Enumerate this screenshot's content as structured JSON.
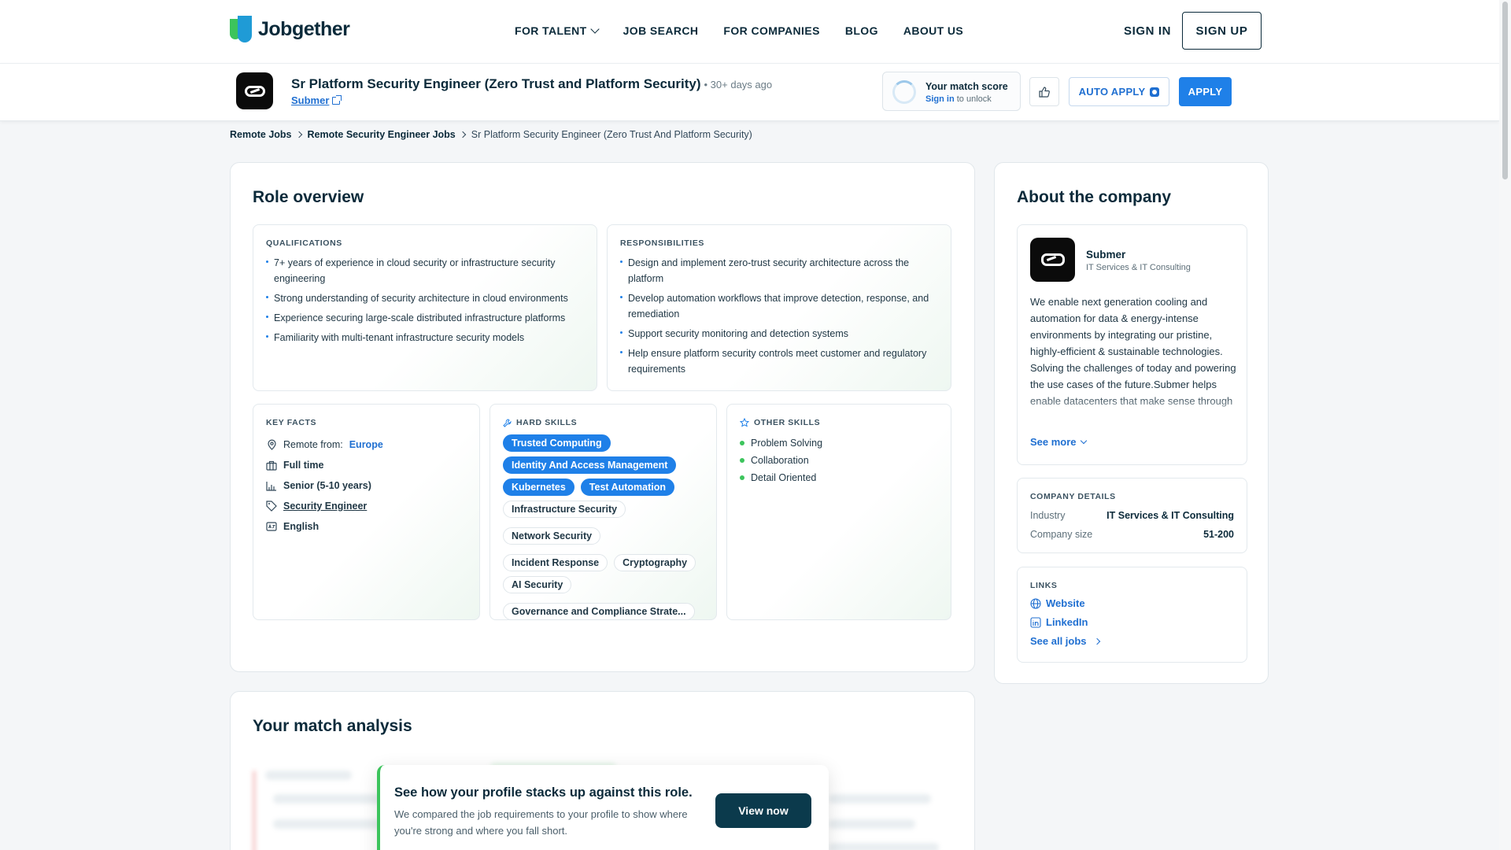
{
  "brand": {
    "name": "Jobgether"
  },
  "nav": {
    "links": [
      "FOR TALENT",
      "JOB SEARCH",
      "FOR COMPANIES",
      "BLOG",
      "ABOUT US"
    ],
    "sign_in": "SIGN IN",
    "sign_up": "SIGN UP"
  },
  "job": {
    "title": "Sr Platform Security Engineer (Zero Trust and Platform Security)",
    "age": "• 30+ days ago",
    "company": "Submer",
    "match_title": "Your match score",
    "match_sign_in": "Sign in",
    "match_rest": " to unlock",
    "auto_apply": "AUTO APPLY",
    "apply": "APPLY"
  },
  "breadcrumb": [
    "Remote Jobs",
    "Remote Security Engineer Jobs",
    "Sr Platform Security Engineer (Zero Trust And Platform Security)"
  ],
  "role": {
    "heading": "Role overview",
    "qualifications_label": "QUALIFICATIONS",
    "qualifications": [
      "7+ years of experience in cloud security or infrastructure security engineering",
      "Strong understanding of security architecture in cloud environments",
      "Experience securing large-scale distributed infrastructure platforms",
      "Familiarity with multi-tenant infrastructure security models"
    ],
    "responsibilities_label": "RESPONSIBILITIES",
    "responsibilities": [
      "Design and implement zero-trust security architecture across the platform",
      "Develop automation workflows that improve detection, response, and remediation",
      "Support security monitoring and detection systems",
      "Help ensure platform security controls meet customer and regulatory requirements"
    ],
    "key_facts_label": "KEY FACTS",
    "facts": {
      "remote_prefix": "Remote from: ",
      "remote_value": "Europe",
      "employment": "Full time",
      "seniority": "Senior (5-10 years)",
      "category": "Security Engineer",
      "language": "English"
    },
    "hard_skills_label": "HARD SKILLS",
    "hard_skills": [
      "Trusted Computing",
      "Identity And Access Management",
      "Kubernetes",
      "Test Automation",
      "Infrastructure Security",
      "Network Security",
      "Incident Response",
      "Cryptography",
      "AI Security",
      "Governance and Compliance Strate..."
    ],
    "other_skills_label": "OTHER SKILLS",
    "other_skills": [
      "Problem Solving",
      "Collaboration",
      "Detail Oriented"
    ]
  },
  "about": {
    "heading": "About the company",
    "name": "Submer",
    "industry": "IT Services & IT Consulting",
    "description": "We enable next generation cooling and automation for data & energy-intense environments by integrating our pristine, highly-efficient & sustainable technologies. Solving the challenges of today and powering the use cases of the future.Submer helps enable datacenters that make sense through",
    "see_more": "See more",
    "details_label": "COMPANY DETAILS",
    "industry_key": "Industry",
    "industry_value": "IT Services & IT Consulting",
    "size_key": "Company size",
    "size_value": "51-200",
    "links_label": "LINKS",
    "website": "Website",
    "linkedin": "LinkedIn",
    "see_all": "See all jobs"
  },
  "match": {
    "heading": "Your match analysis",
    "promo_title": "See how your profile stacks up against this role.",
    "promo_text": "We compared the job requirements to your profile to show where you're strong and where you fall short.",
    "view_now": "View now"
  },
  "colors": {
    "primary": "#1f80e8",
    "accent_green": "#3cc45c",
    "navy": "#0b2a3a",
    "dark_button": "#0b3a4c"
  }
}
